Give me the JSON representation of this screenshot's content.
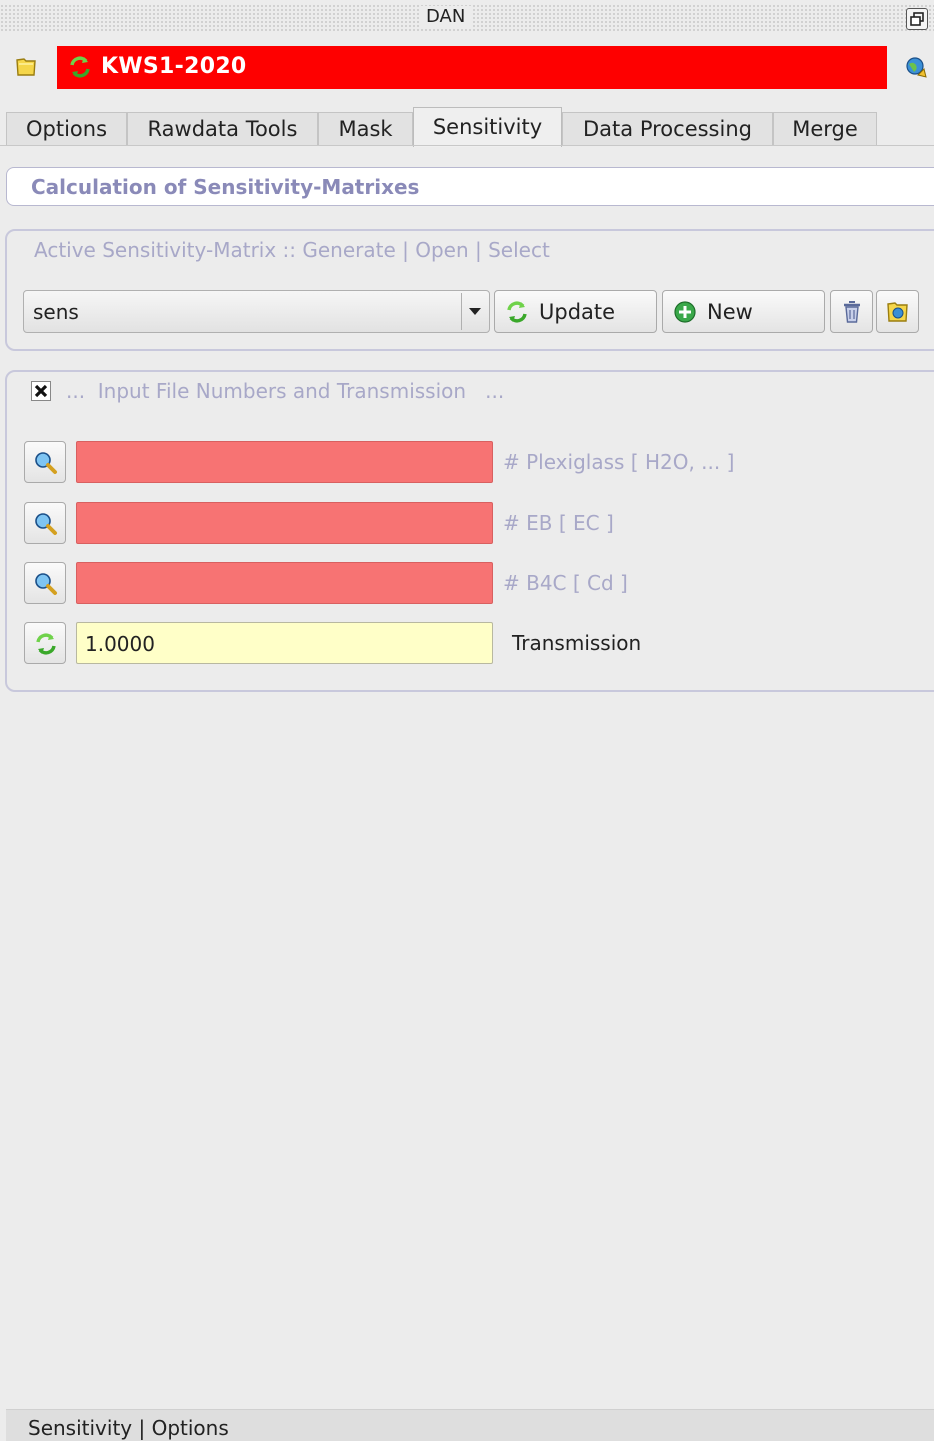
{
  "window": {
    "title": "DAN"
  },
  "header": {
    "instrument": "KWS1-2020"
  },
  "tabs": [
    {
      "label": "Options"
    },
    {
      "label": "Rawdata Tools"
    },
    {
      "label": "Mask"
    },
    {
      "label": "Sensitivity",
      "active": true
    },
    {
      "label": "Data Processing"
    },
    {
      "label": "Merge"
    }
  ],
  "section": {
    "title": "Calculation of Sensitivity-Matrixes"
  },
  "active_matrix": {
    "group_title": "Active Sensitivity-Matrix :: Generate | Open | Select",
    "combo_value": "sens",
    "update_label": "Update",
    "new_label": "New"
  },
  "input_files": {
    "group_title": "...  Input File Numbers and Transmission   ...",
    "checkbox_checked": true,
    "rows": [
      {
        "value": "",
        "hint": "# Plexiglass [ H2O, ... ]"
      },
      {
        "value": "",
        "hint": "# EB [ EC ]"
      },
      {
        "value": "",
        "hint": "# B4C [ Cd ]"
      }
    ],
    "transmission": {
      "value": "1.0000",
      "label": "Transmission"
    }
  },
  "statusbar": {
    "text": "Sensitivity | Options"
  },
  "colors": {
    "banner": "#fe0000",
    "empty_field": "#f77373",
    "transmission_field": "#ffffc8",
    "hint_text": "#a8a8c8"
  },
  "icons": [
    "folder-icon",
    "refresh-icon",
    "globe-icon",
    "new-icon",
    "delete-icon",
    "open-icon",
    "search-icon",
    "checkbox-icon"
  ]
}
